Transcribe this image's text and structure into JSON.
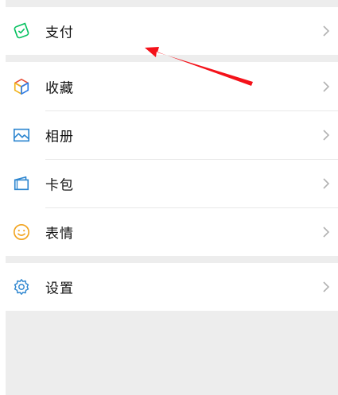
{
  "menu": {
    "pay": {
      "label": "支付",
      "icon": "wallet-check-icon",
      "color": "#07c160"
    },
    "favorites": {
      "label": "收藏",
      "icon": "cube-icon",
      "colors": [
        "#e8503a",
        "#f2b21a",
        "#2c7be5"
      ]
    },
    "album": {
      "label": "相册",
      "icon": "picture-icon",
      "color": "#2f87d0"
    },
    "cards": {
      "label": "卡包",
      "icon": "card-wallet-icon",
      "color": "#2f87d0"
    },
    "stickers": {
      "label": "表情",
      "icon": "smiley-icon",
      "color": "#f2a420"
    },
    "settings": {
      "label": "设置",
      "icon": "gear-icon",
      "color": "#2f87d0"
    }
  },
  "annotation": {
    "icon": "red-arrow-icon",
    "color": "#f4121a"
  }
}
